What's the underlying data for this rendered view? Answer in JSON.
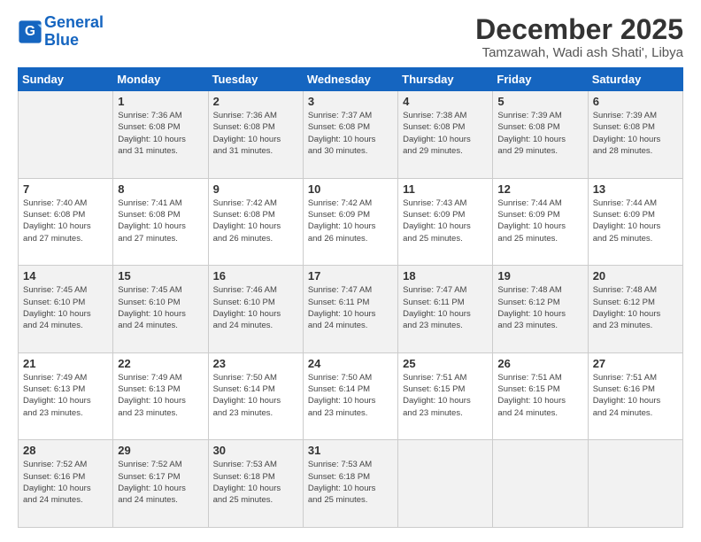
{
  "logo": {
    "line1": "General",
    "line2": "Blue"
  },
  "title": "December 2025",
  "location": "Tamzawah, Wadi ash Shati', Libya",
  "weekdays": [
    "Sunday",
    "Monday",
    "Tuesday",
    "Wednesday",
    "Thursday",
    "Friday",
    "Saturday"
  ],
  "weeks": [
    [
      {
        "day": "",
        "info": ""
      },
      {
        "day": "1",
        "info": "Sunrise: 7:36 AM\nSunset: 6:08 PM\nDaylight: 10 hours\nand 31 minutes."
      },
      {
        "day": "2",
        "info": "Sunrise: 7:36 AM\nSunset: 6:08 PM\nDaylight: 10 hours\nand 31 minutes."
      },
      {
        "day": "3",
        "info": "Sunrise: 7:37 AM\nSunset: 6:08 PM\nDaylight: 10 hours\nand 30 minutes."
      },
      {
        "day": "4",
        "info": "Sunrise: 7:38 AM\nSunset: 6:08 PM\nDaylight: 10 hours\nand 29 minutes."
      },
      {
        "day": "5",
        "info": "Sunrise: 7:39 AM\nSunset: 6:08 PM\nDaylight: 10 hours\nand 29 minutes."
      },
      {
        "day": "6",
        "info": "Sunrise: 7:39 AM\nSunset: 6:08 PM\nDaylight: 10 hours\nand 28 minutes."
      }
    ],
    [
      {
        "day": "7",
        "info": "Sunrise: 7:40 AM\nSunset: 6:08 PM\nDaylight: 10 hours\nand 27 minutes."
      },
      {
        "day": "8",
        "info": "Sunrise: 7:41 AM\nSunset: 6:08 PM\nDaylight: 10 hours\nand 27 minutes."
      },
      {
        "day": "9",
        "info": "Sunrise: 7:42 AM\nSunset: 6:08 PM\nDaylight: 10 hours\nand 26 minutes."
      },
      {
        "day": "10",
        "info": "Sunrise: 7:42 AM\nSunset: 6:09 PM\nDaylight: 10 hours\nand 26 minutes."
      },
      {
        "day": "11",
        "info": "Sunrise: 7:43 AM\nSunset: 6:09 PM\nDaylight: 10 hours\nand 25 minutes."
      },
      {
        "day": "12",
        "info": "Sunrise: 7:44 AM\nSunset: 6:09 PM\nDaylight: 10 hours\nand 25 minutes."
      },
      {
        "day": "13",
        "info": "Sunrise: 7:44 AM\nSunset: 6:09 PM\nDaylight: 10 hours\nand 25 minutes."
      }
    ],
    [
      {
        "day": "14",
        "info": "Sunrise: 7:45 AM\nSunset: 6:10 PM\nDaylight: 10 hours\nand 24 minutes."
      },
      {
        "day": "15",
        "info": "Sunrise: 7:45 AM\nSunset: 6:10 PM\nDaylight: 10 hours\nand 24 minutes."
      },
      {
        "day": "16",
        "info": "Sunrise: 7:46 AM\nSunset: 6:10 PM\nDaylight: 10 hours\nand 24 minutes."
      },
      {
        "day": "17",
        "info": "Sunrise: 7:47 AM\nSunset: 6:11 PM\nDaylight: 10 hours\nand 24 minutes."
      },
      {
        "day": "18",
        "info": "Sunrise: 7:47 AM\nSunset: 6:11 PM\nDaylight: 10 hours\nand 23 minutes."
      },
      {
        "day": "19",
        "info": "Sunrise: 7:48 AM\nSunset: 6:12 PM\nDaylight: 10 hours\nand 23 minutes."
      },
      {
        "day": "20",
        "info": "Sunrise: 7:48 AM\nSunset: 6:12 PM\nDaylight: 10 hours\nand 23 minutes."
      }
    ],
    [
      {
        "day": "21",
        "info": "Sunrise: 7:49 AM\nSunset: 6:13 PM\nDaylight: 10 hours\nand 23 minutes."
      },
      {
        "day": "22",
        "info": "Sunrise: 7:49 AM\nSunset: 6:13 PM\nDaylight: 10 hours\nand 23 minutes."
      },
      {
        "day": "23",
        "info": "Sunrise: 7:50 AM\nSunset: 6:14 PM\nDaylight: 10 hours\nand 23 minutes."
      },
      {
        "day": "24",
        "info": "Sunrise: 7:50 AM\nSunset: 6:14 PM\nDaylight: 10 hours\nand 23 minutes."
      },
      {
        "day": "25",
        "info": "Sunrise: 7:51 AM\nSunset: 6:15 PM\nDaylight: 10 hours\nand 23 minutes."
      },
      {
        "day": "26",
        "info": "Sunrise: 7:51 AM\nSunset: 6:15 PM\nDaylight: 10 hours\nand 24 minutes."
      },
      {
        "day": "27",
        "info": "Sunrise: 7:51 AM\nSunset: 6:16 PM\nDaylight: 10 hours\nand 24 minutes."
      }
    ],
    [
      {
        "day": "28",
        "info": "Sunrise: 7:52 AM\nSunset: 6:16 PM\nDaylight: 10 hours\nand 24 minutes."
      },
      {
        "day": "29",
        "info": "Sunrise: 7:52 AM\nSunset: 6:17 PM\nDaylight: 10 hours\nand 24 minutes."
      },
      {
        "day": "30",
        "info": "Sunrise: 7:53 AM\nSunset: 6:18 PM\nDaylight: 10 hours\nand 25 minutes."
      },
      {
        "day": "31",
        "info": "Sunrise: 7:53 AM\nSunset: 6:18 PM\nDaylight: 10 hours\nand 25 minutes."
      },
      {
        "day": "",
        "info": ""
      },
      {
        "day": "",
        "info": ""
      },
      {
        "day": "",
        "info": ""
      }
    ]
  ]
}
